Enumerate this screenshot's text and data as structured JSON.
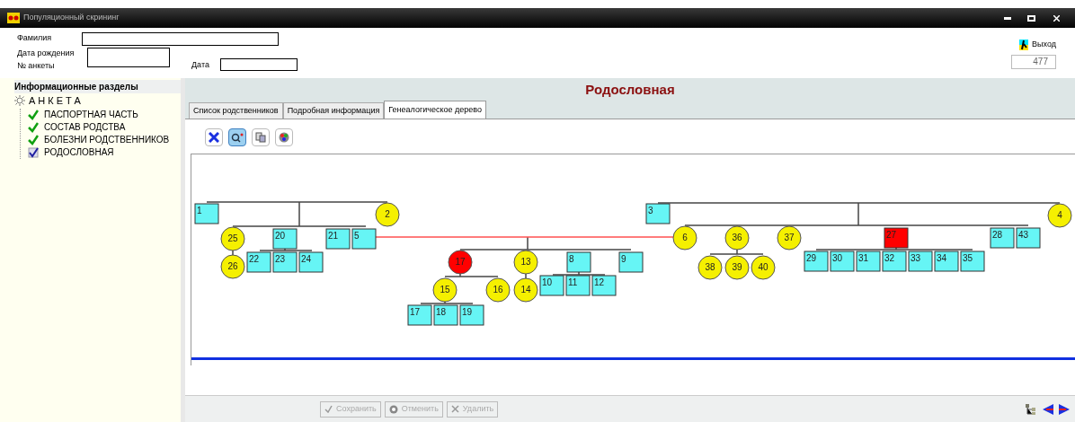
{
  "window": {
    "title": "Популяционный скрининг"
  },
  "header": {
    "fields": [
      {
        "label": "Фамилия"
      },
      {
        "label": "Дата рождения"
      },
      {
        "label": "№ анкеты"
      },
      {
        "label": "Дата"
      }
    ],
    "exit_label": "Выход",
    "number": "477"
  },
  "sidebar": {
    "title": "Информационные разделы",
    "root": "АНКЕТА",
    "items": [
      {
        "label": "ПАСПОРТНАЯ ЧАСТЬ",
        "selected": false
      },
      {
        "label": "СОСТАВ РОДСТВА",
        "selected": false
      },
      {
        "label": "БОЛЕЗНИ РОДСТВЕННИКОВ",
        "selected": false
      },
      {
        "label": "РОДОСЛОВНАЯ",
        "selected": true
      }
    ]
  },
  "panel": {
    "title": "Родословная"
  },
  "tabs": [
    {
      "label": "Список родственников",
      "selected": false
    },
    {
      "label": "Подробная информация",
      "selected": false
    },
    {
      "label": "Генеалогическое дерево",
      "selected": true
    }
  ],
  "pedigree": {
    "nodes": [
      {
        "label": "1",
        "kind": "square",
        "color": "#66f5f5"
      },
      {
        "label": "2",
        "kind": "circle",
        "color": "#f5f000"
      },
      {
        "label": "3",
        "kind": "square",
        "color": "#66f5f5"
      },
      {
        "label": "4",
        "kind": "circle",
        "color": "#f5f000"
      },
      {
        "label": "25",
        "kind": "circle",
        "color": "#f5f000"
      },
      {
        "label": "20",
        "kind": "square",
        "color": "#66f5f5"
      },
      {
        "label": "21",
        "kind": "square",
        "color": "#66f5f5"
      },
      {
        "label": "5",
        "kind": "square",
        "color": "#66f5f5"
      },
      {
        "label": "6",
        "kind": "circle",
        "color": "#f5f000"
      },
      {
        "label": "36",
        "kind": "circle",
        "color": "#f5f000"
      },
      {
        "label": "37",
        "kind": "circle",
        "color": "#f5f000"
      },
      {
        "label": "27",
        "kind": "square",
        "color": "#ff0000"
      },
      {
        "label": "28",
        "kind": "square",
        "color": "#66f5f5"
      },
      {
        "label": "43",
        "kind": "square",
        "color": "#66f5f5"
      },
      {
        "label": "26",
        "kind": "circle",
        "color": "#f5f000"
      },
      {
        "label": "22",
        "kind": "square",
        "color": "#66f5f5"
      },
      {
        "label": "23",
        "kind": "square",
        "color": "#66f5f5"
      },
      {
        "label": "24",
        "kind": "square",
        "color": "#66f5f5"
      },
      {
        "label": "17",
        "kind": "circle",
        "color": "#ff0000"
      },
      {
        "label": "13",
        "kind": "circle",
        "color": "#f5f000"
      },
      {
        "label": "8",
        "kind": "square",
        "color": "#66f5f5"
      },
      {
        "label": "9",
        "kind": "square",
        "color": "#66f5f5"
      },
      {
        "label": "38",
        "kind": "circle",
        "color": "#f5f000"
      },
      {
        "label": "39",
        "kind": "circle",
        "color": "#f5f000"
      },
      {
        "label": "40",
        "kind": "circle",
        "color": "#f5f000"
      },
      {
        "label": "29",
        "kind": "square",
        "color": "#66f5f5"
      },
      {
        "label": "30",
        "kind": "square",
        "color": "#66f5f5"
      },
      {
        "label": "31",
        "kind": "square",
        "color": "#66f5f5"
      },
      {
        "label": "32",
        "kind": "square",
        "color": "#66f5f5"
      },
      {
        "label": "33",
        "kind": "square",
        "color": "#66f5f5"
      },
      {
        "label": "34",
        "kind": "square",
        "color": "#66f5f5"
      },
      {
        "label": "35",
        "kind": "square",
        "color": "#66f5f5"
      },
      {
        "label": "15",
        "kind": "circle",
        "color": "#f5f000"
      },
      {
        "label": "16",
        "kind": "circle",
        "color": "#f5f000"
      },
      {
        "label": "14",
        "kind": "circle",
        "color": "#f5f000"
      },
      {
        "label": "10",
        "kind": "square",
        "color": "#66f5f5"
      },
      {
        "label": "11",
        "kind": "square",
        "color": "#66f5f5"
      },
      {
        "label": "12",
        "kind": "square",
        "color": "#66f5f5"
      },
      {
        "label": "17",
        "kind": "square",
        "color": "#66f5f5"
      },
      {
        "label": "18",
        "kind": "square",
        "color": "#66f5f5"
      },
      {
        "label": "19",
        "kind": "square",
        "color": "#66f5f5"
      }
    ]
  },
  "buttons": [
    {
      "label": "Сохранить",
      "disabled": true
    },
    {
      "label": "Отменить",
      "disabled": true
    },
    {
      "label": "Удалить",
      "disabled": true
    }
  ]
}
